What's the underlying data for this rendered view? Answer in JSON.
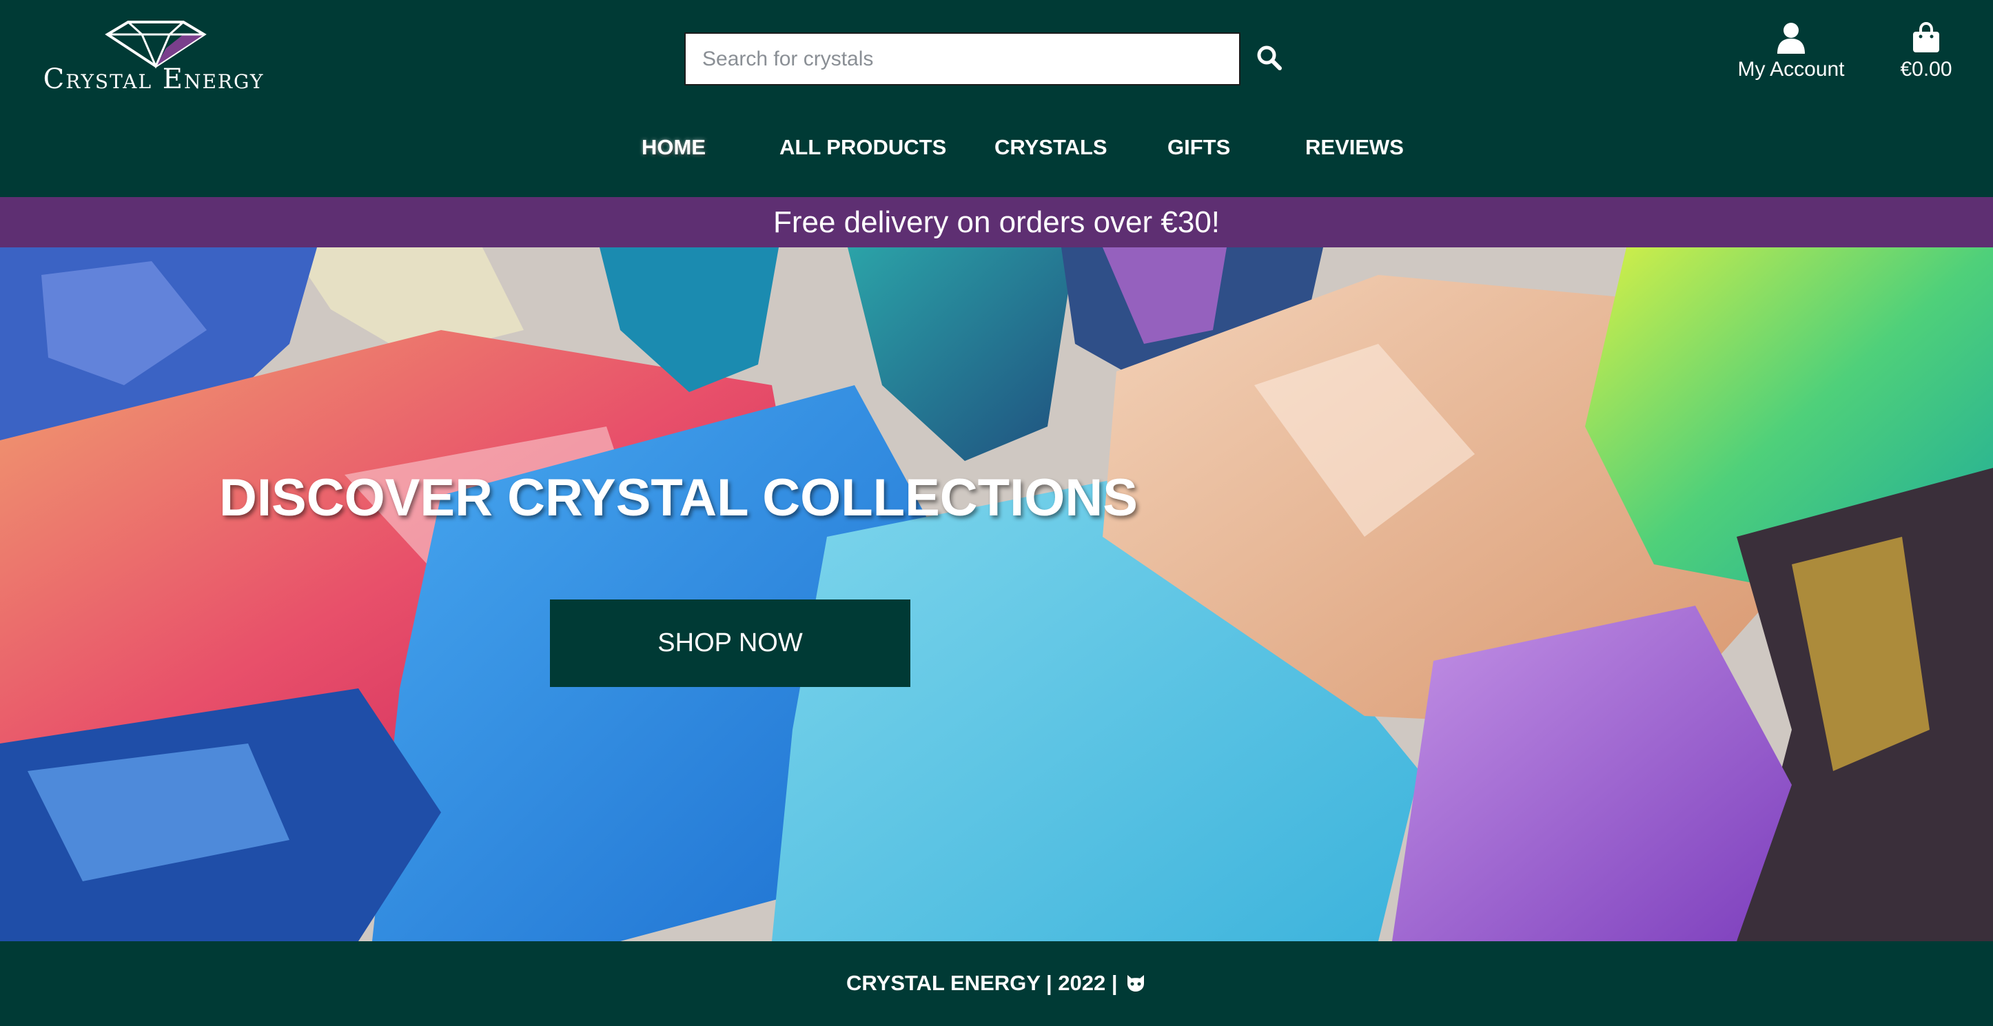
{
  "brand": {
    "name": "Crystal Energy"
  },
  "search": {
    "placeholder": "Search for crystals"
  },
  "header": {
    "account_label": "My Account",
    "bag_total": "€0.00"
  },
  "nav": {
    "items": [
      {
        "label": "HOME",
        "active": true
      },
      {
        "label": "ALL PRODUCTS",
        "active": false
      },
      {
        "label": "CRYSTALS",
        "active": false
      },
      {
        "label": "GIFTS",
        "active": false
      },
      {
        "label": "REVIEWS",
        "active": false
      }
    ]
  },
  "banner": {
    "text": "Free delivery on orders over €30!"
  },
  "hero": {
    "title": "DISCOVER CRYSTAL COLLECTIONS",
    "button_label": "SHOP NOW"
  },
  "footer": {
    "text": "CRYSTAL ENERGY | 2022 |"
  },
  "colors": {
    "primary": "#003a35",
    "banner": "#5e2f72",
    "text": "#ffffff"
  },
  "icons": {
    "search": "search-icon",
    "account": "user-icon",
    "bag": "shopping-bag-icon",
    "footer": "github-icon",
    "logo": "gem-icon"
  }
}
